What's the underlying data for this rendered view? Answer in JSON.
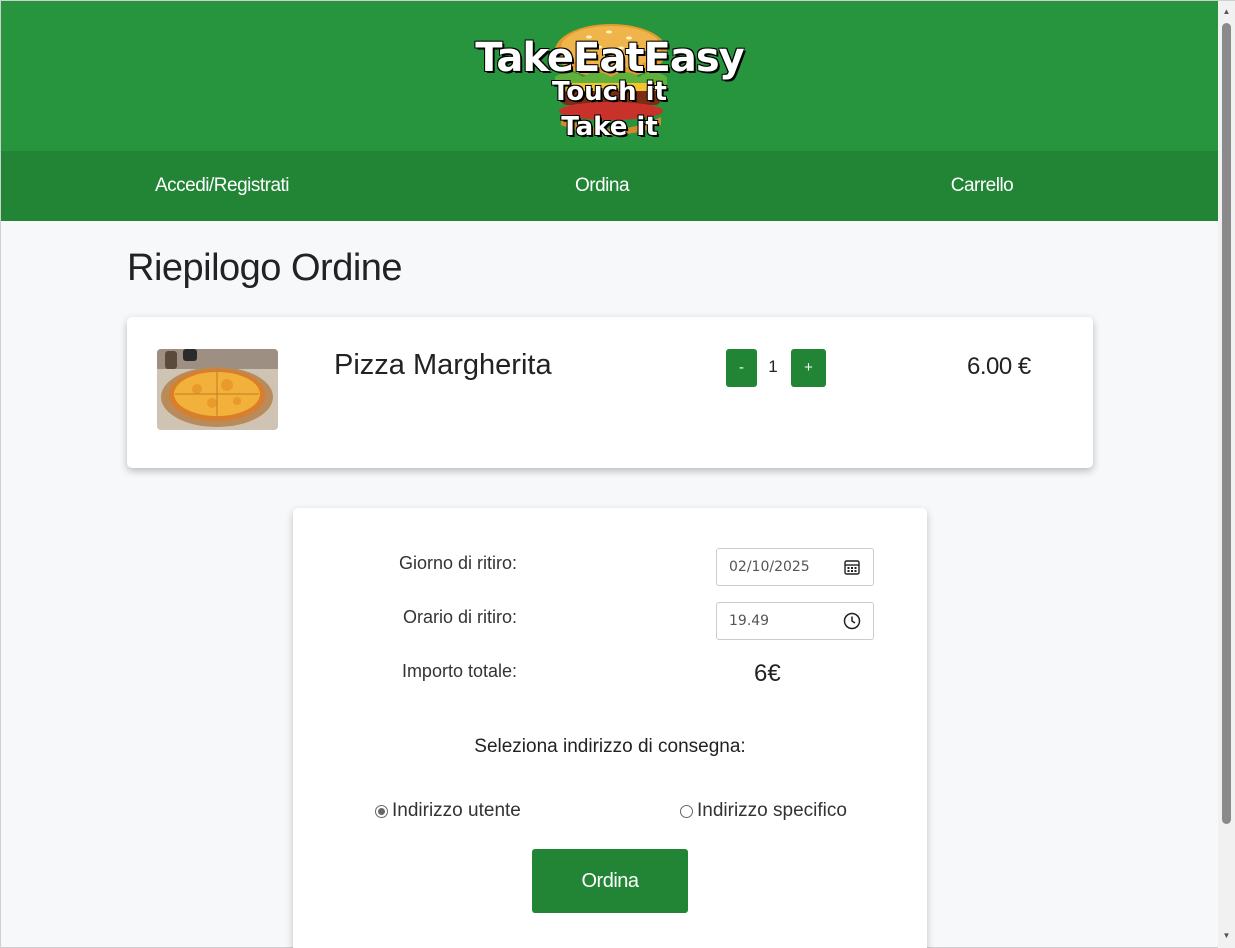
{
  "header": {
    "logo_title": "TakeEatEasy",
    "logo_line1": "Touch it",
    "logo_line2": "Take it"
  },
  "nav": {
    "items": [
      {
        "label": "Accedi/Registrati"
      },
      {
        "label": "Ordina"
      },
      {
        "label": "Carrello"
      }
    ]
  },
  "main": {
    "title": "Riepilogo Ordine",
    "cart_item": {
      "name": "Pizza Margherita",
      "minus_label": "-",
      "quantity": "1",
      "plus_label": "+",
      "price": "6.00 €"
    },
    "form": {
      "pickup_day_label": "Giorno di ritiro:",
      "pickup_day_value": "02/10/2025",
      "pickup_time_label": "Orario di ritiro:",
      "pickup_time_value": "19.49",
      "total_label": "Importo totale:",
      "total_value": "6€",
      "address_heading": "Seleziona indirizzo di consegna:",
      "address_options": [
        {
          "label": "Indirizzo utente",
          "checked": true
        },
        {
          "label": "Indirizzo specifico",
          "checked": false
        }
      ],
      "order_button_label": "Ordina"
    }
  },
  "colors": {
    "header_green": "#26953e",
    "nav_green": "#218535",
    "button_green": "#218535",
    "page_background": "#f7f8fa"
  },
  "icons": {
    "logo": "burger-icon",
    "date_input": "calendar-icon",
    "time_input": "clock-icon"
  }
}
